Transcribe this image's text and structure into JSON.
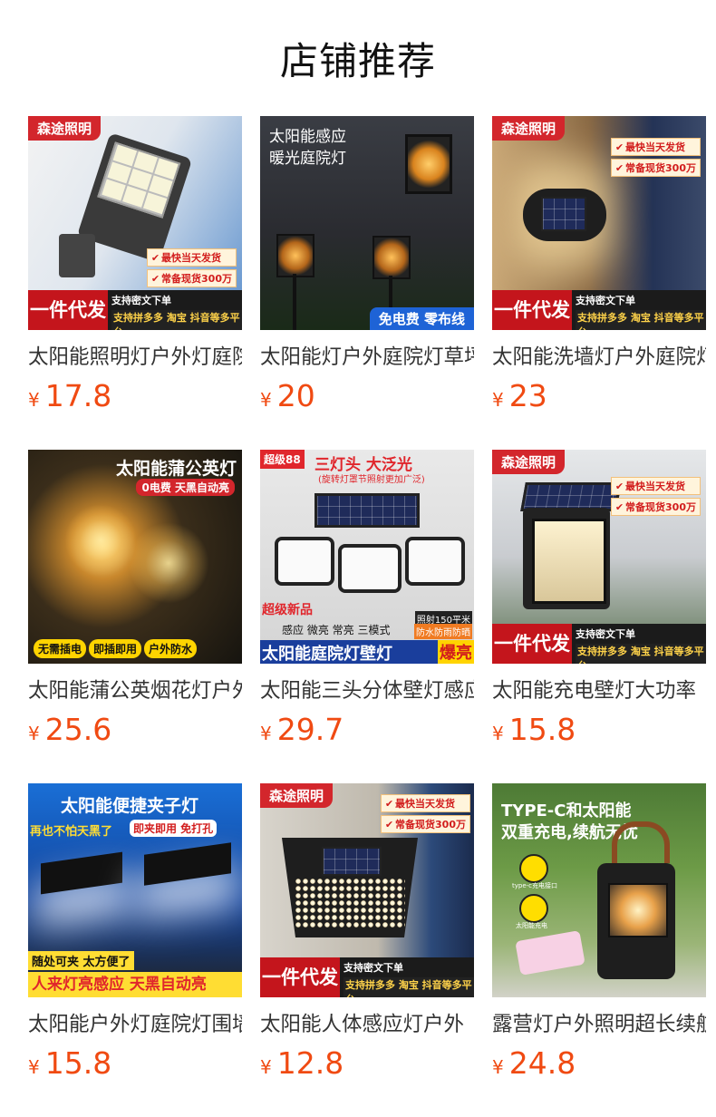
{
  "header": {
    "title": "店铺推荐"
  },
  "currency": "¥",
  "products": [
    {
      "name": "太阳能照明灯户外灯庭院灯",
      "price": "17.8",
      "overlay": {
        "brand": "森途照明",
        "tags": [
          "最快当天发货",
          "常备现货300万"
        ],
        "badge": "一件代发",
        "line1": "支持密文下单",
        "line2": "支持拼多多 淘宝 抖音等多平台"
      }
    },
    {
      "name": "太阳能灯户外庭院灯草坪灯",
      "price": "20",
      "overlay": {
        "title_line1": "太阳能感应",
        "title_line2": "暖光庭院灯",
        "banner": "免电费 零布线"
      }
    },
    {
      "name": "太阳能洗墙灯户外庭院灯",
      "price": "23",
      "overlay": {
        "brand": "森途照明",
        "tags": [
          "最快当天发货",
          "常备现货300万"
        ],
        "badge": "一件代发",
        "line1": "支持密文下单",
        "line2": "支持拼多多 淘宝 抖音等多平台"
      }
    },
    {
      "name": "太阳能蒲公英烟花灯户外",
      "price": "25.6",
      "overlay": {
        "title": "太阳能蒲公英灯",
        "subtitle": "0电费 天黑自动亮",
        "pills": [
          "无需插电",
          "即插即用",
          "户外防水"
        ]
      }
    },
    {
      "name": "太阳能三头分体壁灯感应",
      "price": "29.7",
      "overlay": {
        "corner": "超级88",
        "title": "三灯头 大泛光",
        "subtitle": "(旋转灯罩节照射更加广泛)",
        "new": "超级新品",
        "modes": "感应 微亮 常亮 三模式",
        "area": "照射150平米",
        "waterproof": "防水防雨防晒",
        "banner": "太阳能庭院灯壁灯",
        "hot": "爆亮"
      }
    },
    {
      "name": "太阳能充电壁灯大功率",
      "price": "15.8",
      "overlay": {
        "brand": "森途照明",
        "tags": [
          "最快当天发货",
          "常备现货300万"
        ],
        "badge": "一件代发",
        "line1": "支持密文下单",
        "line2": "支持拼多多 淘宝 抖音等多平台"
      }
    },
    {
      "name": "太阳能户外灯庭院灯围墙",
      "price": "15.8",
      "overlay": {
        "title": "太阳能便捷夹子灯",
        "sub1": "再也不怕天黑了",
        "sub2": "即夹即用 免打孔",
        "bottom1": "随处可夹 太方便了",
        "bottom2": "人来灯亮感应 天黑自动亮"
      }
    },
    {
      "name": "太阳能人体感应灯户外",
      "price": "12.8",
      "overlay": {
        "brand": "森途照明",
        "tags": [
          "最快当天发货",
          "常备现货300万"
        ],
        "badge": "一件代发",
        "line1": "支持密文下单",
        "line2": "支持拼多多 淘宝 抖音等多平台"
      }
    },
    {
      "name": "露营灯户外照明超长续航",
      "price": "24.8",
      "overlay": {
        "title_line1": "TYPE-C和太阳能",
        "title_line2": "双重充电,续航无忧",
        "icon1_label": "type-c充电接口",
        "icon2_label": "太阳能充电"
      }
    }
  ]
}
